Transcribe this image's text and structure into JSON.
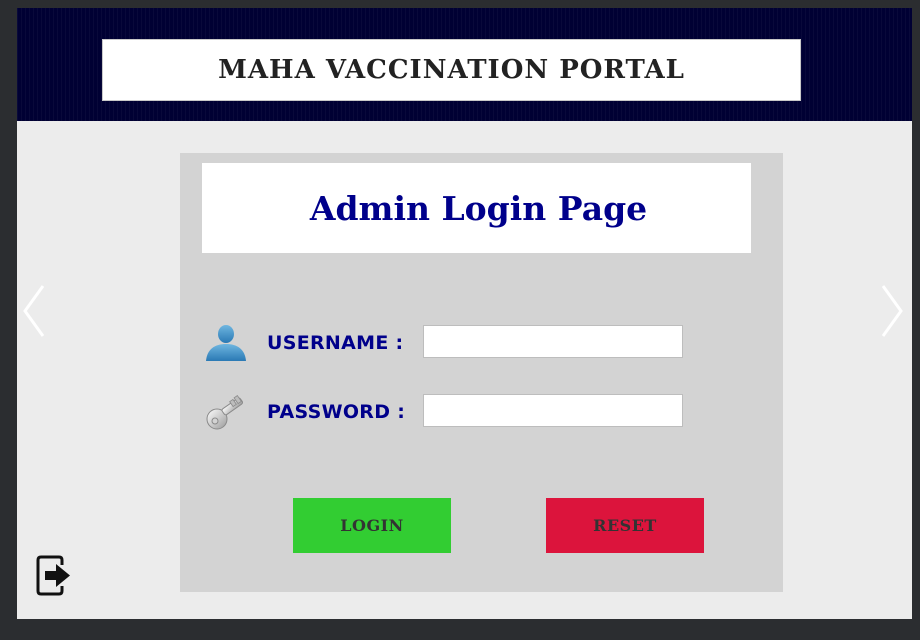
{
  "header": {
    "title": "MAHA VACCINATION PORTAL",
    "bg_color": "#000033"
  },
  "panel": {
    "subtitle": "Admin Login Page",
    "subtitle_color": "#00008b",
    "bg_color": "#d3d3d3"
  },
  "form": {
    "username": {
      "label": "USERNAME :",
      "value": "",
      "icon": "user-icon"
    },
    "password": {
      "label": "PASSWORD :",
      "value": "",
      "icon": "key-icon"
    }
  },
  "buttons": {
    "login": {
      "label": "LOGIN",
      "color": "#32cd32"
    },
    "reset": {
      "label": "RESET",
      "color": "#dc143c"
    }
  },
  "nav": {
    "prev_icon": "chevron-left-icon",
    "next_icon": "chevron-right-icon"
  },
  "logout": {
    "icon": "logout-icon"
  }
}
